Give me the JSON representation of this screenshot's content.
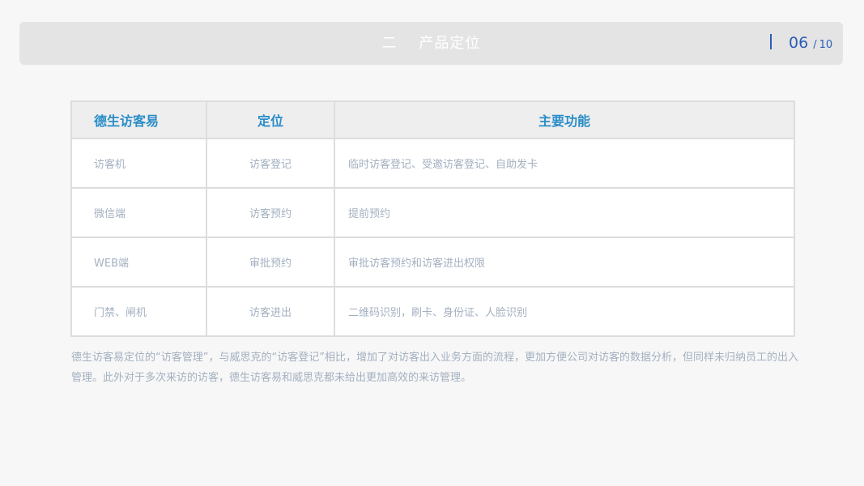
{
  "header": {
    "title": "二    产品定位",
    "page_current": "06",
    "page_separator": "/",
    "page_total": "10"
  },
  "table": {
    "headers": [
      "德生访客易",
      "定位",
      "主要功能"
    ],
    "rows": [
      {
        "name": "访客机",
        "position": "访客登记",
        "function": "临时访客登记、受邀访客登记、自助发卡"
      },
      {
        "name": "微信端",
        "position": "访客预约",
        "function": "提前预约"
      },
      {
        "name": "WEB端",
        "position": "审批预约",
        "function": "审批访客预约和访客进出权限"
      },
      {
        "name": "门禁、闸机",
        "position": "访客进出",
        "function": "二维码识别，刷卡、身份证、人脸识别"
      }
    ]
  },
  "footnote": "德生访客易定位的“访客管理”，与威思克的“访客登记”相比，增加了对访客出入业务方面的流程，更加方便公司对访客的数据分析，但同样未归纳员工的出入管理。此外对于多次来访的访客，德生访客易和威思克都未给出更加高效的来访管理。",
  "colors": {
    "header_bg": "#e4e4e4",
    "accent_blue": "#2b5cb8",
    "table_header_text": "#2a8ec8",
    "body_text": "#a3b0c0",
    "page_bg": "#f7f7f7"
  }
}
